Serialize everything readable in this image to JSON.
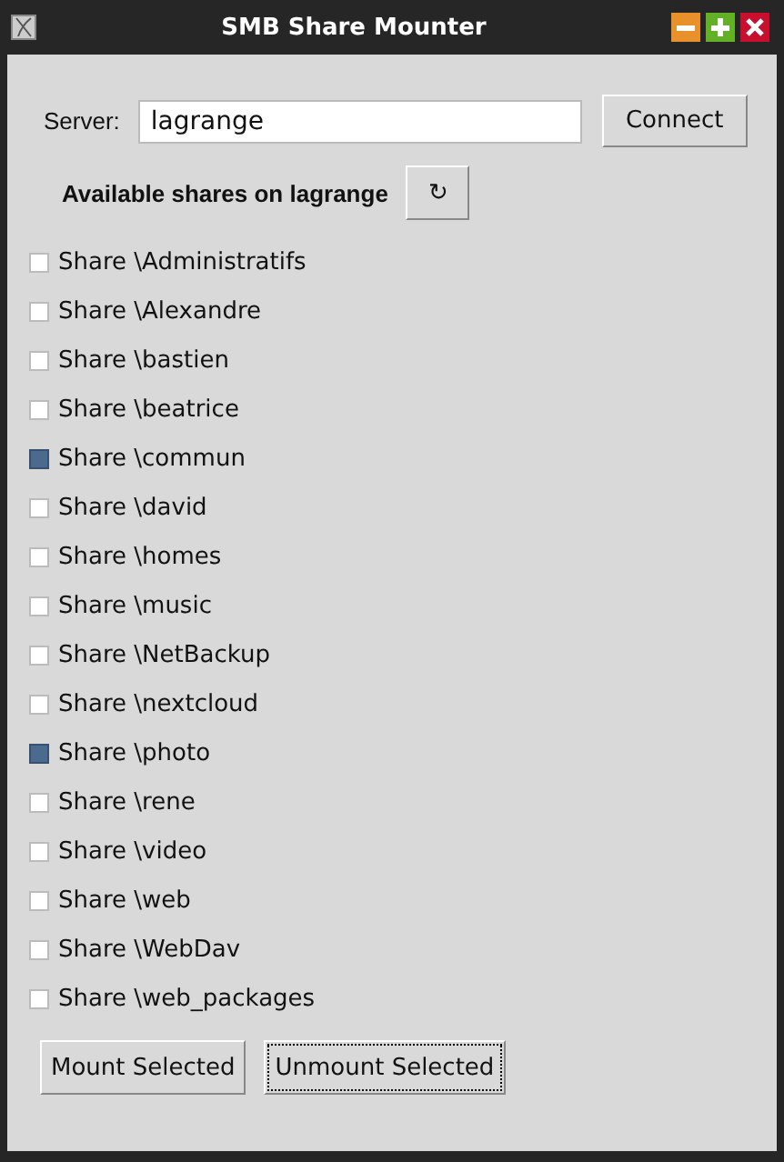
{
  "window": {
    "title": "SMB Share Mounter"
  },
  "server": {
    "label": "Server:",
    "value": "lagrange"
  },
  "connect_button": {
    "label": "Connect"
  },
  "shares_heading": "Available shares on lagrange",
  "refresh_button": {
    "label": "↻"
  },
  "shares": [
    {
      "label": "Share \\Administratifs",
      "checked": false
    },
    {
      "label": "Share \\Alexandre",
      "checked": false
    },
    {
      "label": "Share \\bastien",
      "checked": false
    },
    {
      "label": "Share \\beatrice",
      "checked": false
    },
    {
      "label": "Share \\commun",
      "checked": true
    },
    {
      "label": "Share \\david",
      "checked": false
    },
    {
      "label": "Share \\homes",
      "checked": false
    },
    {
      "label": "Share \\music",
      "checked": false
    },
    {
      "label": "Share \\NetBackup",
      "checked": false
    },
    {
      "label": "Share \\nextcloud",
      "checked": false
    },
    {
      "label": "Share \\photo",
      "checked": true
    },
    {
      "label": "Share \\rene",
      "checked": false
    },
    {
      "label": "Share \\video",
      "checked": false
    },
    {
      "label": "Share \\web",
      "checked": false
    },
    {
      "label": "Share \\WebDav",
      "checked": false
    },
    {
      "label": "Share \\web_packages",
      "checked": false
    }
  ],
  "buttons": [
    {
      "label": "Mount Selected",
      "focused": false
    },
    {
      "label": "Unmount Selected",
      "focused": true
    }
  ]
}
